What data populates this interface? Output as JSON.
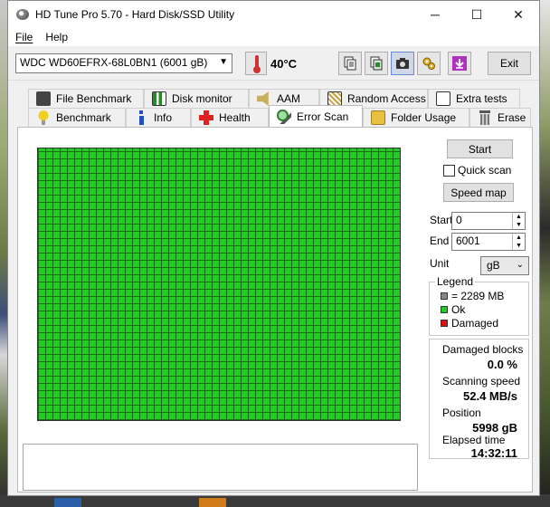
{
  "window": {
    "title": "HD Tune Pro 5.70 - Hard Disk/SSD Utility",
    "controls": {
      "minimize": "─",
      "maximize": "☐",
      "close": "✕"
    }
  },
  "menu": {
    "file": "File",
    "help": "Help"
  },
  "toolbar": {
    "drive": "WDC WD60EFRX-68L0BN1 (6001 gB)",
    "temperature": "40°C",
    "exit_label": "Exit",
    "icons": [
      "copy-text-icon",
      "copy-screen-icon",
      "screenshot-camera-icon",
      "options-icon",
      "save-arrow-icon"
    ]
  },
  "tabs": {
    "row1": [
      "File Benchmark",
      "Disk monitor",
      "AAM",
      "Random Access",
      "Extra tests"
    ],
    "row2": [
      "Benchmark",
      "Info",
      "Health",
      "Error Scan",
      "Folder Usage",
      "Erase"
    ],
    "active": "Error Scan"
  },
  "scan": {
    "start_button": "Start",
    "quick_scan_label": "Quick scan",
    "quick_scan_checked": false,
    "speed_map_button": "Speed map",
    "start_label": "Start",
    "start_value": "0",
    "end_label": "End",
    "end_value": "6001",
    "unit_label": "Unit",
    "unit_value": "gB"
  },
  "legend": {
    "title": "Legend",
    "block": "= 2289 MB",
    "ok": "Ok",
    "damaged": "Damaged",
    "colors": {
      "block": "#888888",
      "ok": "#22cc22",
      "damaged": "#dd1111"
    }
  },
  "stats": {
    "damaged_blocks_label": "Damaged blocks",
    "damaged_blocks_value": "0.0 %",
    "scanning_speed_label": "Scanning speed",
    "scanning_speed_value": "52.4 MB/s",
    "position_label": "Position",
    "position_value": "5998 gB",
    "elapsed_label": "Elapsed time",
    "elapsed_value": "14:32:11"
  }
}
